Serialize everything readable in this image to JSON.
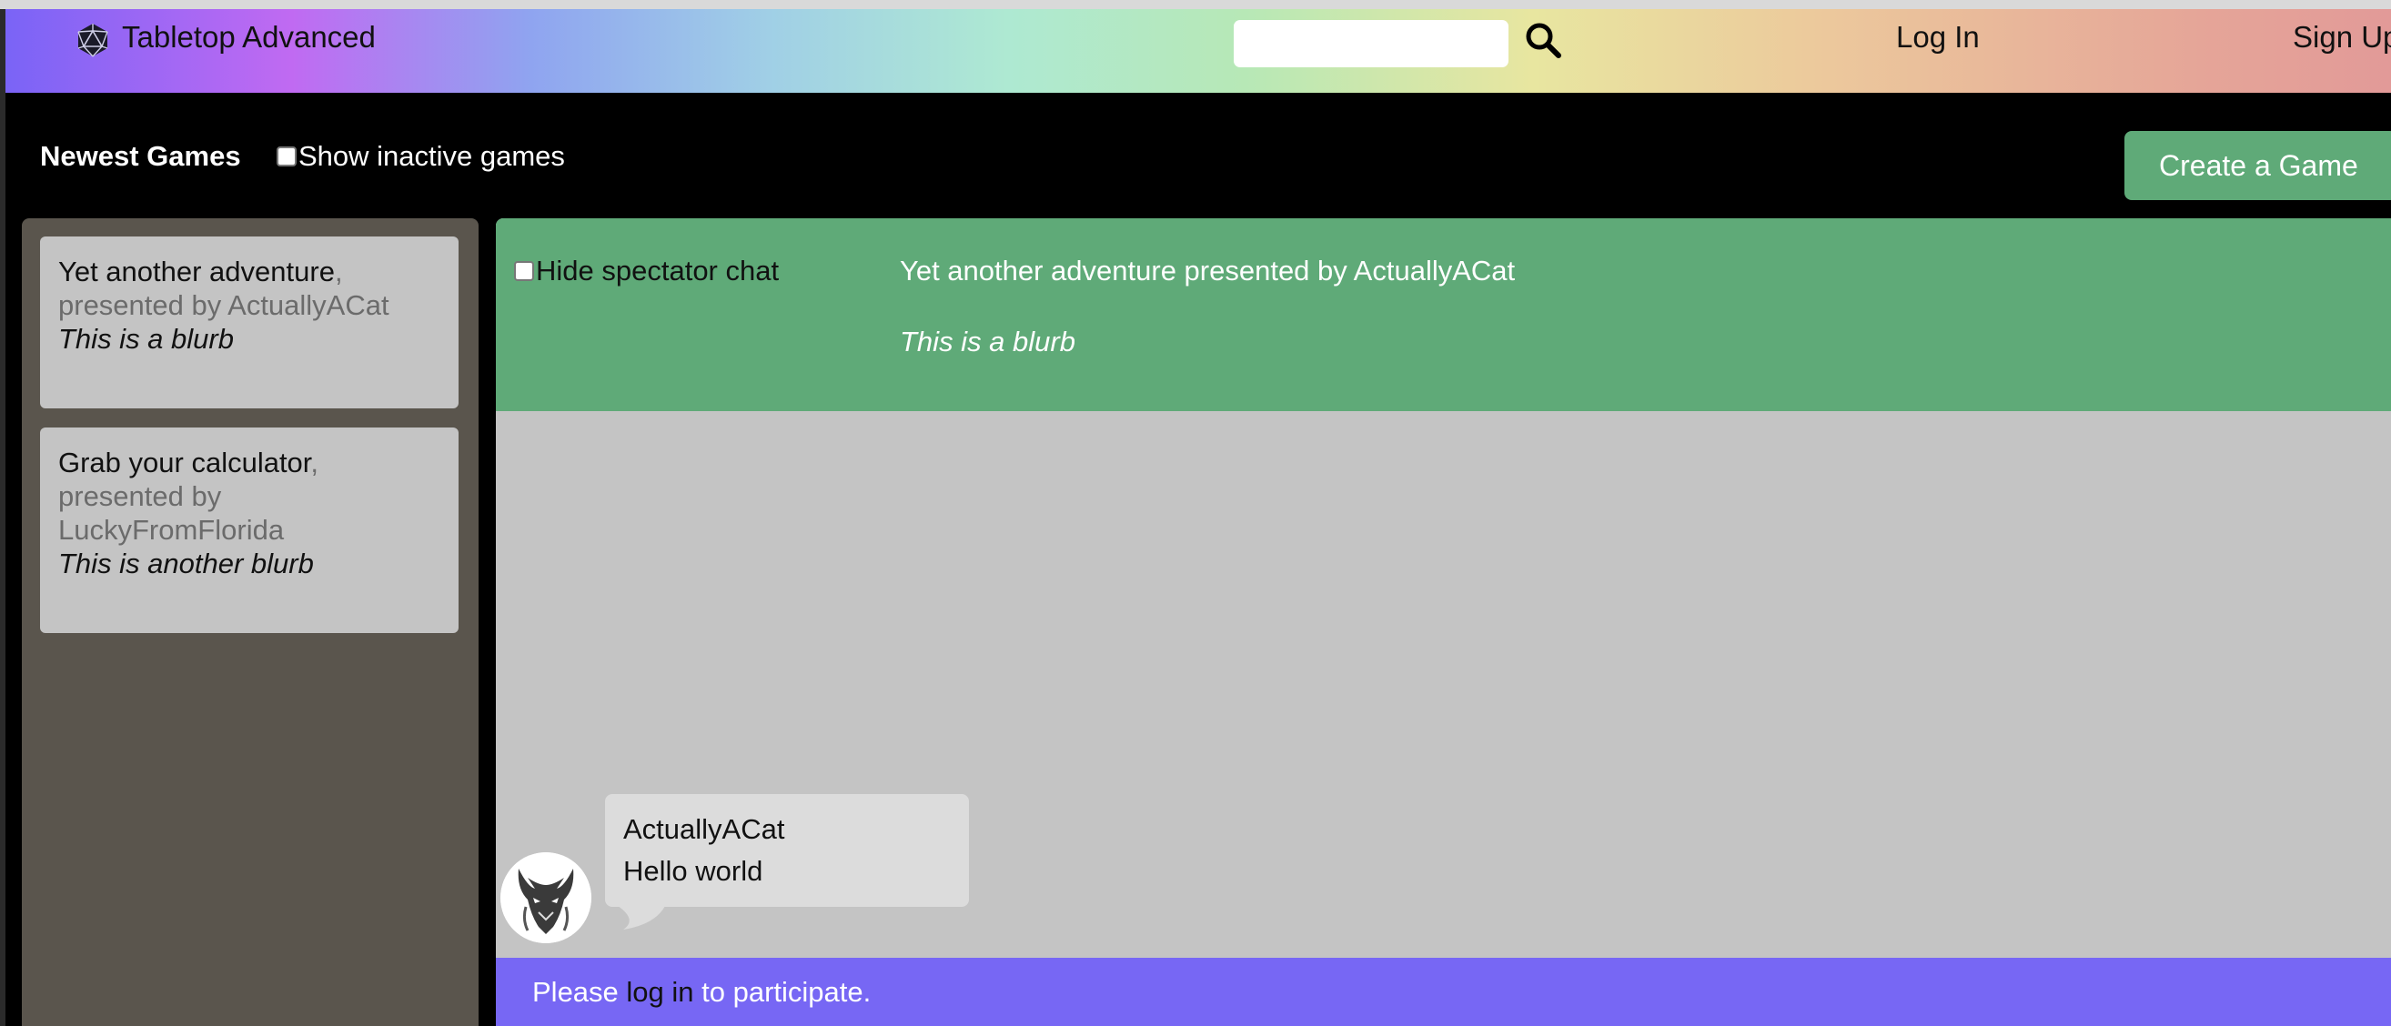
{
  "header": {
    "app_title": "Tabletop Advanced",
    "logo_icon": "d20-dice-icon",
    "search": {
      "value": "",
      "placeholder": ""
    },
    "search_icon": "search-icon",
    "login_label": "Log In",
    "signup_label": "Sign Up"
  },
  "toolbar": {
    "newest_label": "Newest Games",
    "show_inactive_label": "Show inactive games",
    "show_inactive_checked": false,
    "create_label": "Create a Game"
  },
  "sidebar": {
    "games": [
      {
        "title": "Yet another adventure",
        "comma": ",",
        "by": "presented by ActuallyACat",
        "blurb": "This is a blurb"
      },
      {
        "title": "Grab your calculator",
        "comma": ",",
        "by": "presented by LuckyFromFlorida",
        "blurb": "This is another blurb"
      }
    ]
  },
  "game": {
    "hide_spectator_label": "Hide spectator chat",
    "hide_spectator_checked": false,
    "heading": "Yet another adventure presented by ActuallyACat",
    "blurb": "This is a blurb"
  },
  "chat": {
    "messages": [
      {
        "author": "ActuallyACat",
        "text": "Hello world",
        "avatar": "dragon-avatar"
      }
    ]
  },
  "footer": {
    "before": "Please ",
    "link": "log in",
    "after": " to participate."
  },
  "colors": {
    "green": "#5faa78",
    "purple": "#7767f4",
    "sidebar_bg": "#5a554d",
    "card_bg": "#c4c4c4"
  }
}
